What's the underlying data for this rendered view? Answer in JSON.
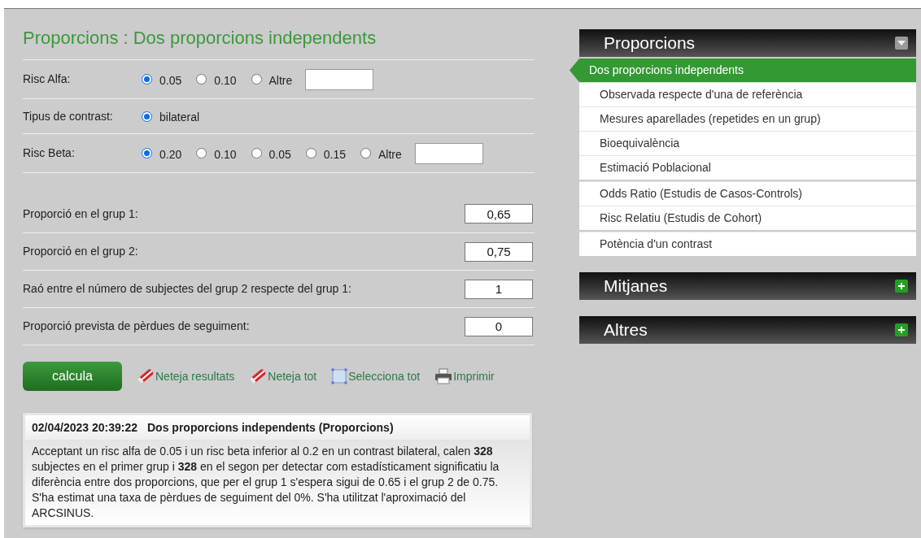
{
  "title": "Proporcions : Dos proporcions independents",
  "options": [
    {
      "label": "Risc Alfa:",
      "radios": [
        {
          "label": "0.05",
          "selected": true
        },
        {
          "label": "0.10",
          "selected": false
        },
        {
          "label": "Altre",
          "selected": false
        }
      ],
      "kind": "choice_with_field"
    },
    {
      "label": "Tipus de contrast:",
      "radios": [
        {
          "label": "bilateral",
          "selected": true
        }
      ],
      "kind": "choice"
    },
    {
      "label": "Risc Beta:",
      "radios": [
        {
          "label": "0.20",
          "selected": true
        },
        {
          "label": "0.10",
          "selected": false
        },
        {
          "label": "0.05",
          "selected": false
        },
        {
          "label": "0.15",
          "selected": false
        },
        {
          "label": "Altre",
          "selected": false
        }
      ],
      "kind": "choice_with_field"
    }
  ],
  "inputs": [
    {
      "label": "Proporció en el grup 1:",
      "value": "0,65"
    },
    {
      "label": "Proporció en el grup 2:",
      "value": "0,75"
    },
    {
      "label": "Raó entre el número de subjectes del grup 2 respecte del grup 1:",
      "value": "1"
    },
    {
      "label": "Proporció prevista de pèrdues de seguiment:",
      "value": "0"
    }
  ],
  "calculate_button": "calcula",
  "actions": [
    {
      "kind": "eraser",
      "label": "Neteja resultats"
    },
    {
      "kind": "eraser",
      "label": "Neteja tot"
    },
    {
      "kind": "select",
      "label": "Selecciona tot"
    },
    {
      "kind": "print",
      "label": "Imprimir"
    }
  ],
  "result": {
    "timestamp": "02/04/2023 20:39:22",
    "title": "Dos proporcions independents (Proporcions)",
    "text": "Acceptant un risc alfa de 0.05 i un risc beta inferior al 0.2 en un contrast bilateral, calen **328** subjectes en el primer grup i **328** en el segon per detectar com estadísticament significatiu la diferència entre dos proporcions, que per el grup 1 s'espera sigui de 0.65 i el grup 2 de 0.75. S'ha estimat una taxa de pèrdues de seguiment del 0%. S'ha utilitzat l'aproximació del ARCSINUS."
  },
  "sidebar": [
    {
      "title": "Proporcions",
      "expanded": true,
      "groups": [
        [
          {
            "label": "Dos proporcions independents",
            "selected": true
          },
          {
            "label": "Observada respecte d'una de referència",
            "selected": false
          },
          {
            "label": "Mesures aparellades (repetides en un grup)",
            "selected": false
          },
          {
            "label": "Bioequivalència",
            "selected": false
          },
          {
            "label": "Estimació Poblacional",
            "selected": false
          }
        ],
        [
          {
            "label": "Odds Ratio (Estudis de Casos-Controls)",
            "selected": false
          },
          {
            "label": "Risc Relatiu (Estudis de Cohort)",
            "selected": false
          }
        ],
        [
          {
            "label": "Potència d'un contrast",
            "selected": false
          }
        ]
      ]
    },
    {
      "title": "Mitjanes",
      "expanded": false
    },
    {
      "title": "Altres",
      "expanded": false
    }
  ]
}
